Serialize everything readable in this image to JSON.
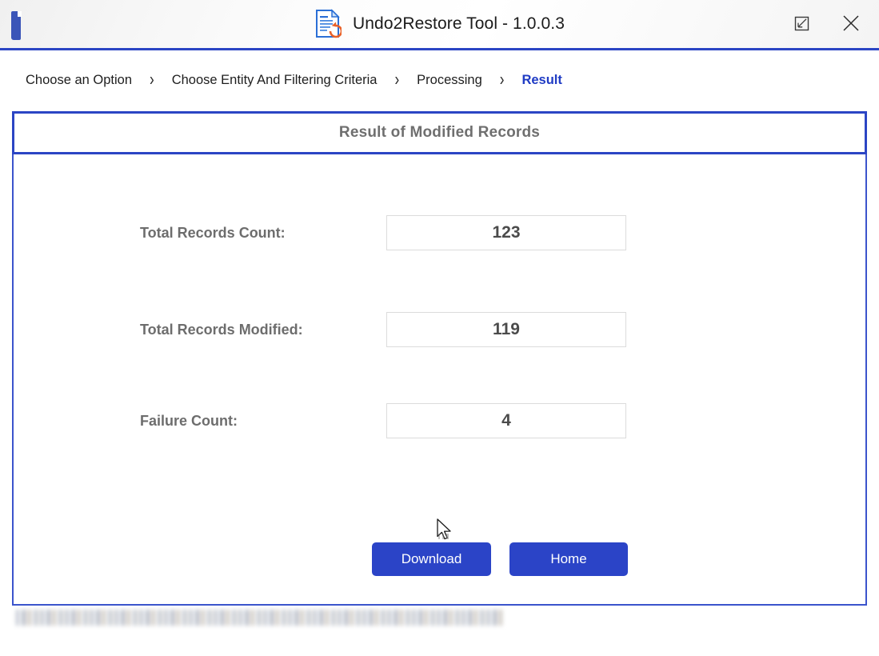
{
  "window": {
    "title": "Undo2Restore Tool - 1.0.0.3",
    "app_icon": "document-undo-icon",
    "brand_mark": "brand-logo-mark",
    "controls": {
      "restore_label": "restore-down-icon",
      "close_label": "close-icon"
    }
  },
  "breadcrumb": {
    "separator": "›",
    "steps": [
      {
        "label": "Choose an Option",
        "active": false
      },
      {
        "label": "Choose Entity And Filtering Criteria",
        "active": false
      },
      {
        "label": "Processing",
        "active": false
      },
      {
        "label": "Result",
        "active": true
      }
    ]
  },
  "panel": {
    "header_title": "Result of Modified Records",
    "fields": [
      {
        "label": "Total Records Count:",
        "value": "123"
      },
      {
        "label": "Total Records Modified:",
        "value": "119"
      },
      {
        "label": "Failure Count:",
        "value": "4"
      }
    ],
    "buttons": {
      "download": "Download",
      "home": "Home"
    }
  },
  "status_bar": {
    "text": "",
    "redacted": true
  },
  "colors": {
    "accent_blue": "#2b45c4",
    "button_blue": "#2b44c7",
    "label_gray": "#6d6d6d",
    "value_gray": "#4b4b4b",
    "field_border": "#dcdcdc"
  }
}
